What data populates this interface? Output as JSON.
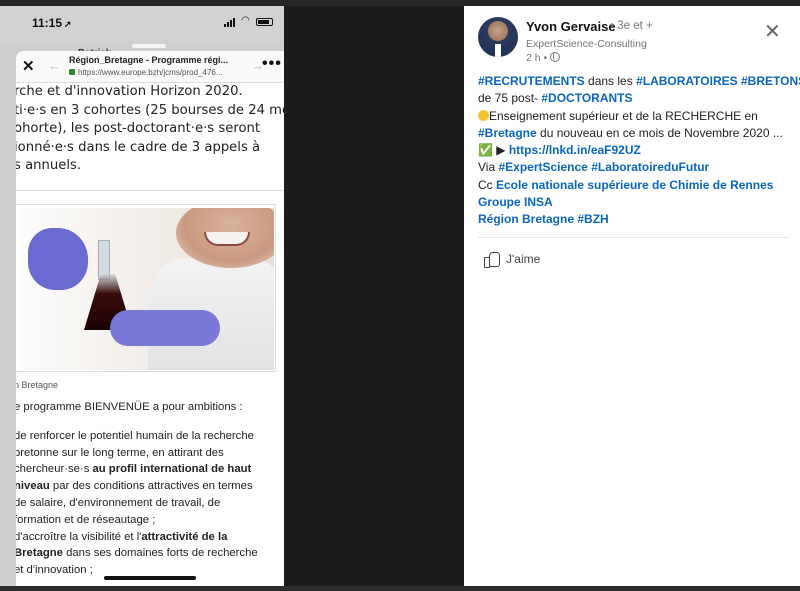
{
  "phone": {
    "time": "11:15",
    "behind_name": "Patrick ...",
    "browser": {
      "title": "Région_Bretagne - Programme régi...",
      "url": "https://www.europe.bzh/jcms/prod_476..."
    },
    "article": {
      "intro_lines": [
        "rche et d'innovation Horizon 2020.",
        "ti·e·s en 3 cohortes (25 bourses de 24 mois",
        "ohorte), les post-doctorant·e·s seront",
        "ionné·e·s dans le cadre de 3 appels à",
        "s annuels."
      ],
      "photo_credit": "n Bretagne",
      "ambitions_line": "e programme BIENVENÜE a pour ambitions :",
      "body_lines": [
        {
          "pre": "de renforcer le potentiel humain de la recherche",
          "bold": "",
          "post": ""
        },
        {
          "pre": "bretonne sur le long terme, en attirant des",
          "bold": "",
          "post": ""
        },
        {
          "pre": "chercheur·se·s ",
          "bold": "au profil international de haut",
          "post": ""
        },
        {
          "pre": "",
          "bold": "niveau",
          "post": " par des conditions attractives en termes"
        },
        {
          "pre": "de salaire, d'environnement de travail, de",
          "bold": "",
          "post": ""
        },
        {
          "pre": "formation et de réseautage ;",
          "bold": "",
          "post": ""
        },
        {
          "pre": "d'accroître la visibilité et l'",
          "bold": "attractivité de la",
          "post": ""
        },
        {
          "pre": "",
          "bold": "Bretagne",
          "post": " dans ses domaines forts de recherche"
        },
        {
          "pre": "et d'innovation ;",
          "bold": "",
          "post": ""
        }
      ]
    }
  },
  "linkedin": {
    "author": "Yvon Gervaise",
    "degree": "• 3e et +",
    "company": "ExpertScience-Consulting",
    "time_ago": "2 h •",
    "post": {
      "l1_tag1": "#RECRUTEMENTS",
      "l1_mid": " dans les ",
      "l1_tag2": "#LABORATOIRES",
      "l1_tag3": "#BRETONS",
      "l2_pre": "de 75 post- ",
      "l2_tag": "#DOCTORANTS",
      "l3": "Enseignement supérieur et de la RECHERCHE en",
      "l4_tag": "#Bretagne",
      "l4_post": " du nouveau en ce mois de Novembre 2020 ...",
      "l5_check": "✅ ▶ ",
      "l5_link": "https://lnkd.in/eaF92UZ",
      "l6_pre": "Via ",
      "l6_tag1": "#ExpertScience",
      "l6_tag2": "#LaboratoireduFutur",
      "l7_pre": "Cc ",
      "l7_link": "Ecole nationale supérieure de Chimie de Rennes",
      "l8_link": "Groupe INSA",
      "l9_link": "Région Bretagne",
      "l9_tag": "#BZH"
    },
    "like_label": "J'aime"
  }
}
